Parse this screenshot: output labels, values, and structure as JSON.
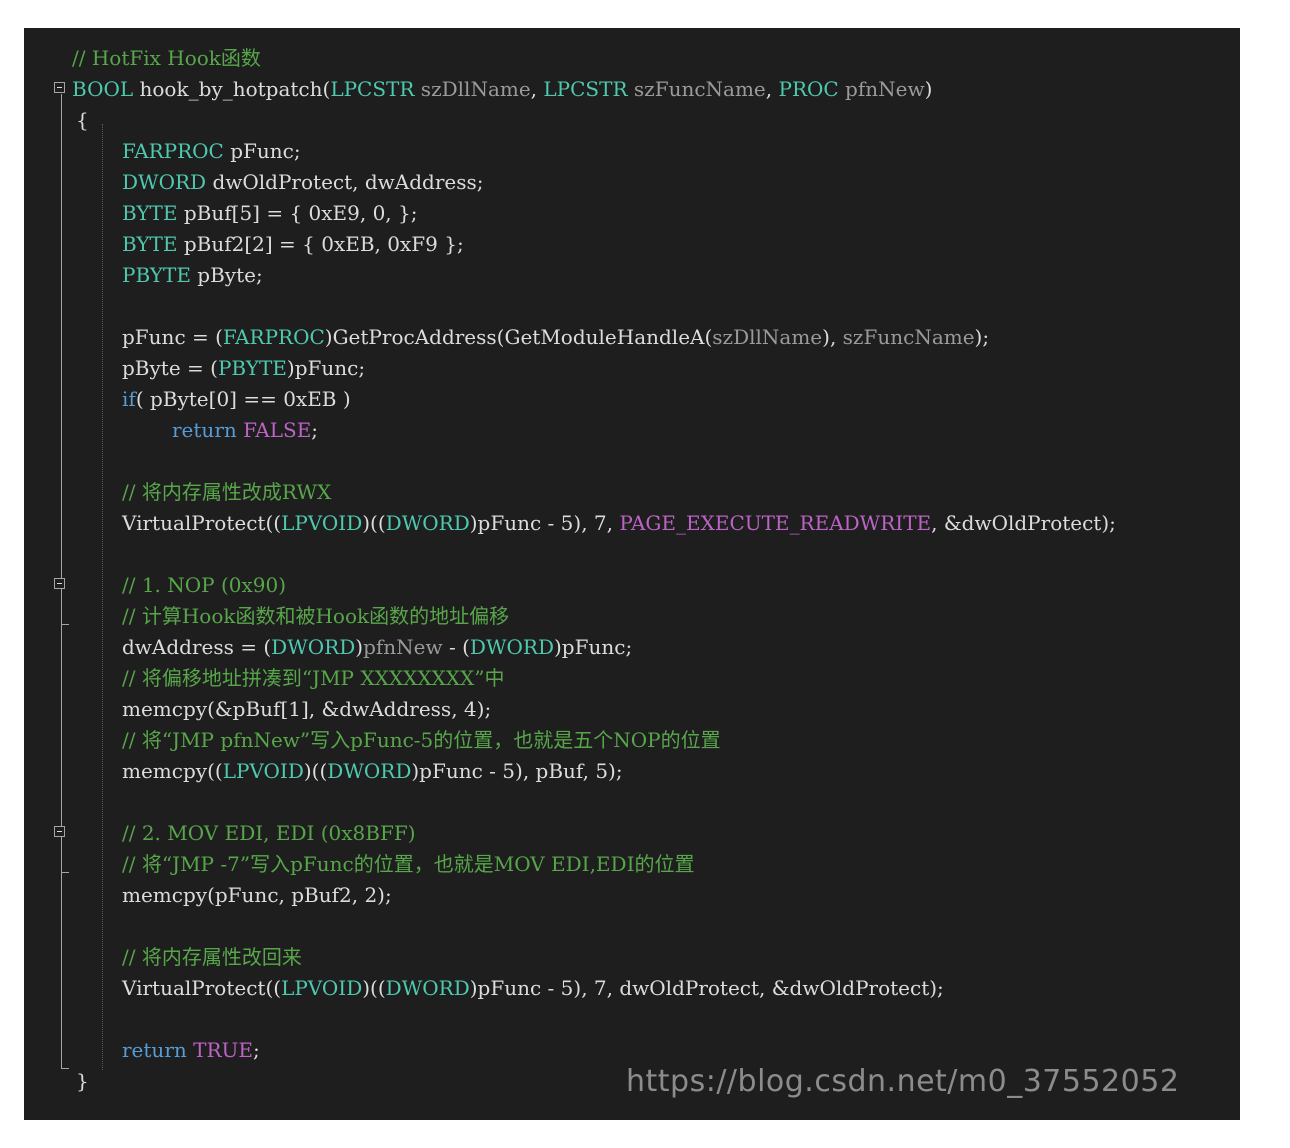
{
  "editor": {
    "watermark": "https://blog.csdn.net/m0_37552052",
    "colors": {
      "background": "#1e1e1e",
      "comment": "#57a64a",
      "type": "#4ec9b0",
      "keyword": "#569cd6",
      "text": "#dcdcdc",
      "param": "#9a9a9a",
      "macro": "#bd63c5"
    },
    "lines": [
      {
        "indent": 0,
        "tokens": [
          {
            "c": "comment",
            "t": "// HotFix Hook函数"
          }
        ]
      },
      {
        "indent": 0,
        "tokens": [
          {
            "c": "type",
            "t": "BOOL"
          },
          {
            "c": "text",
            "t": " hook_by_hotpatch("
          },
          {
            "c": "type",
            "t": "LPCSTR"
          },
          {
            "c": "param",
            "t": " szDllName"
          },
          {
            "c": "text",
            "t": ", "
          },
          {
            "c": "type",
            "t": "LPCSTR"
          },
          {
            "c": "param",
            "t": " szFuncName"
          },
          {
            "c": "text",
            "t": ", "
          },
          {
            "c": "type",
            "t": "PROC"
          },
          {
            "c": "param",
            "t": " pfnNew"
          },
          {
            "c": "text",
            "t": ")"
          }
        ]
      },
      {
        "indent": 1,
        "tokens": [
          {
            "c": "text",
            "t": "{"
          }
        ]
      },
      {
        "indent": 2,
        "tokens": [
          {
            "c": "type",
            "t": "FARPROC"
          },
          {
            "c": "text",
            "t": " pFunc;"
          }
        ]
      },
      {
        "indent": 2,
        "tokens": [
          {
            "c": "type",
            "t": "DWORD"
          },
          {
            "c": "text",
            "t": " dwOldProtect, dwAddress;"
          }
        ]
      },
      {
        "indent": 2,
        "tokens": [
          {
            "c": "type",
            "t": "BYTE"
          },
          {
            "c": "text",
            "t": " pBuf[5] = { 0xE9, 0, };"
          }
        ]
      },
      {
        "indent": 2,
        "tokens": [
          {
            "c": "type",
            "t": "BYTE"
          },
          {
            "c": "text",
            "t": " pBuf2[2] = { 0xEB, 0xF9 };"
          }
        ]
      },
      {
        "indent": 2,
        "tokens": [
          {
            "c": "type",
            "t": "PBYTE"
          },
          {
            "c": "text",
            "t": " pByte;"
          }
        ]
      },
      {
        "indent": 2,
        "tokens": []
      },
      {
        "indent": 2,
        "tokens": [
          {
            "c": "text",
            "t": "pFunc = ("
          },
          {
            "c": "type",
            "t": "FARPROC"
          },
          {
            "c": "text",
            "t": ")GetProcAddress(GetModuleHandleA("
          },
          {
            "c": "param",
            "t": "szDllName"
          },
          {
            "c": "text",
            "t": "), "
          },
          {
            "c": "param",
            "t": "szFuncName"
          },
          {
            "c": "text",
            "t": ");"
          }
        ]
      },
      {
        "indent": 2,
        "tokens": [
          {
            "c": "text",
            "t": "pByte = ("
          },
          {
            "c": "type",
            "t": "PBYTE"
          },
          {
            "c": "text",
            "t": ")pFunc;"
          }
        ]
      },
      {
        "indent": 2,
        "tokens": [
          {
            "c": "keyword",
            "t": "if"
          },
          {
            "c": "text",
            "t": "( pByte[0] == 0xEB )"
          }
        ]
      },
      {
        "indent": 3,
        "tokens": [
          {
            "c": "keyword",
            "t": "return"
          },
          {
            "c": "text",
            "t": " "
          },
          {
            "c": "macro",
            "t": "FALSE"
          },
          {
            "c": "text",
            "t": ";"
          }
        ]
      },
      {
        "indent": 2,
        "tokens": []
      },
      {
        "indent": 2,
        "tokens": [
          {
            "c": "comment",
            "t": "// 将内存属性改成RWX"
          }
        ]
      },
      {
        "indent": 2,
        "tokens": [
          {
            "c": "text",
            "t": "VirtualProtect(("
          },
          {
            "c": "type",
            "t": "LPVOID"
          },
          {
            "c": "text",
            "t": ")(("
          },
          {
            "c": "type",
            "t": "DWORD"
          },
          {
            "c": "text",
            "t": ")pFunc - 5), 7, "
          },
          {
            "c": "macro",
            "t": "PAGE_EXECUTE_READWRITE"
          },
          {
            "c": "text",
            "t": ", &dwOldProtect);"
          }
        ]
      },
      {
        "indent": 2,
        "tokens": []
      },
      {
        "indent": 2,
        "tokens": [
          {
            "c": "comment",
            "t": "// 1. NOP (0x90)"
          }
        ]
      },
      {
        "indent": 2,
        "tokens": [
          {
            "c": "comment",
            "t": "// 计算Hook函数和被Hook函数的地址偏移"
          }
        ]
      },
      {
        "indent": 2,
        "tokens": [
          {
            "c": "text",
            "t": "dwAddress = ("
          },
          {
            "c": "type",
            "t": "DWORD"
          },
          {
            "c": "text",
            "t": ")"
          },
          {
            "c": "param",
            "t": "pfnNew"
          },
          {
            "c": "text",
            "t": " - ("
          },
          {
            "c": "type",
            "t": "DWORD"
          },
          {
            "c": "text",
            "t": ")pFunc;"
          }
        ]
      },
      {
        "indent": 2,
        "tokens": [
          {
            "c": "comment",
            "t": "// 将偏移地址拼凑到“JMP XXXXXXXX”中"
          }
        ]
      },
      {
        "indent": 2,
        "tokens": [
          {
            "c": "text",
            "t": "memcpy(&pBuf[1], &dwAddress, 4);"
          }
        ]
      },
      {
        "indent": 2,
        "tokens": [
          {
            "c": "comment",
            "t": "// 将“JMP pfnNew”写入pFunc-5的位置，也就是五个NOP的位置"
          }
        ]
      },
      {
        "indent": 2,
        "tokens": [
          {
            "c": "text",
            "t": "memcpy(("
          },
          {
            "c": "type",
            "t": "LPVOID"
          },
          {
            "c": "text",
            "t": ")(("
          },
          {
            "c": "type",
            "t": "DWORD"
          },
          {
            "c": "text",
            "t": ")pFunc - 5), pBuf, 5);"
          }
        ]
      },
      {
        "indent": 2,
        "tokens": []
      },
      {
        "indent": 2,
        "tokens": [
          {
            "c": "comment",
            "t": "// 2. MOV EDI, EDI (0x8BFF)"
          }
        ]
      },
      {
        "indent": 2,
        "tokens": [
          {
            "c": "comment",
            "t": "// 将“JMP -7”写入pFunc的位置，也就是MOV EDI,EDI的位置"
          }
        ]
      },
      {
        "indent": 2,
        "tokens": [
          {
            "c": "text",
            "t": "memcpy(pFunc, pBuf2, 2);"
          }
        ]
      },
      {
        "indent": 2,
        "tokens": []
      },
      {
        "indent": 2,
        "tokens": [
          {
            "c": "comment",
            "t": "// 将内存属性改回来"
          }
        ]
      },
      {
        "indent": 2,
        "tokens": [
          {
            "c": "text",
            "t": "VirtualProtect(("
          },
          {
            "c": "type",
            "t": "LPVOID"
          },
          {
            "c": "text",
            "t": ")(("
          },
          {
            "c": "type",
            "t": "DWORD"
          },
          {
            "c": "text",
            "t": ")pFunc - 5), 7, dwOldProtect, &dwOldProtect);"
          }
        ]
      },
      {
        "indent": 2,
        "tokens": []
      },
      {
        "indent": 2,
        "tokens": [
          {
            "c": "keyword",
            "t": "return"
          },
          {
            "c": "text",
            "t": " "
          },
          {
            "c": "macro",
            "t": "TRUE"
          },
          {
            "c": "text",
            "t": ";"
          }
        ]
      },
      {
        "indent": 1,
        "tokens": [
          {
            "c": "text",
            "t": "}"
          }
        ]
      }
    ]
  }
}
